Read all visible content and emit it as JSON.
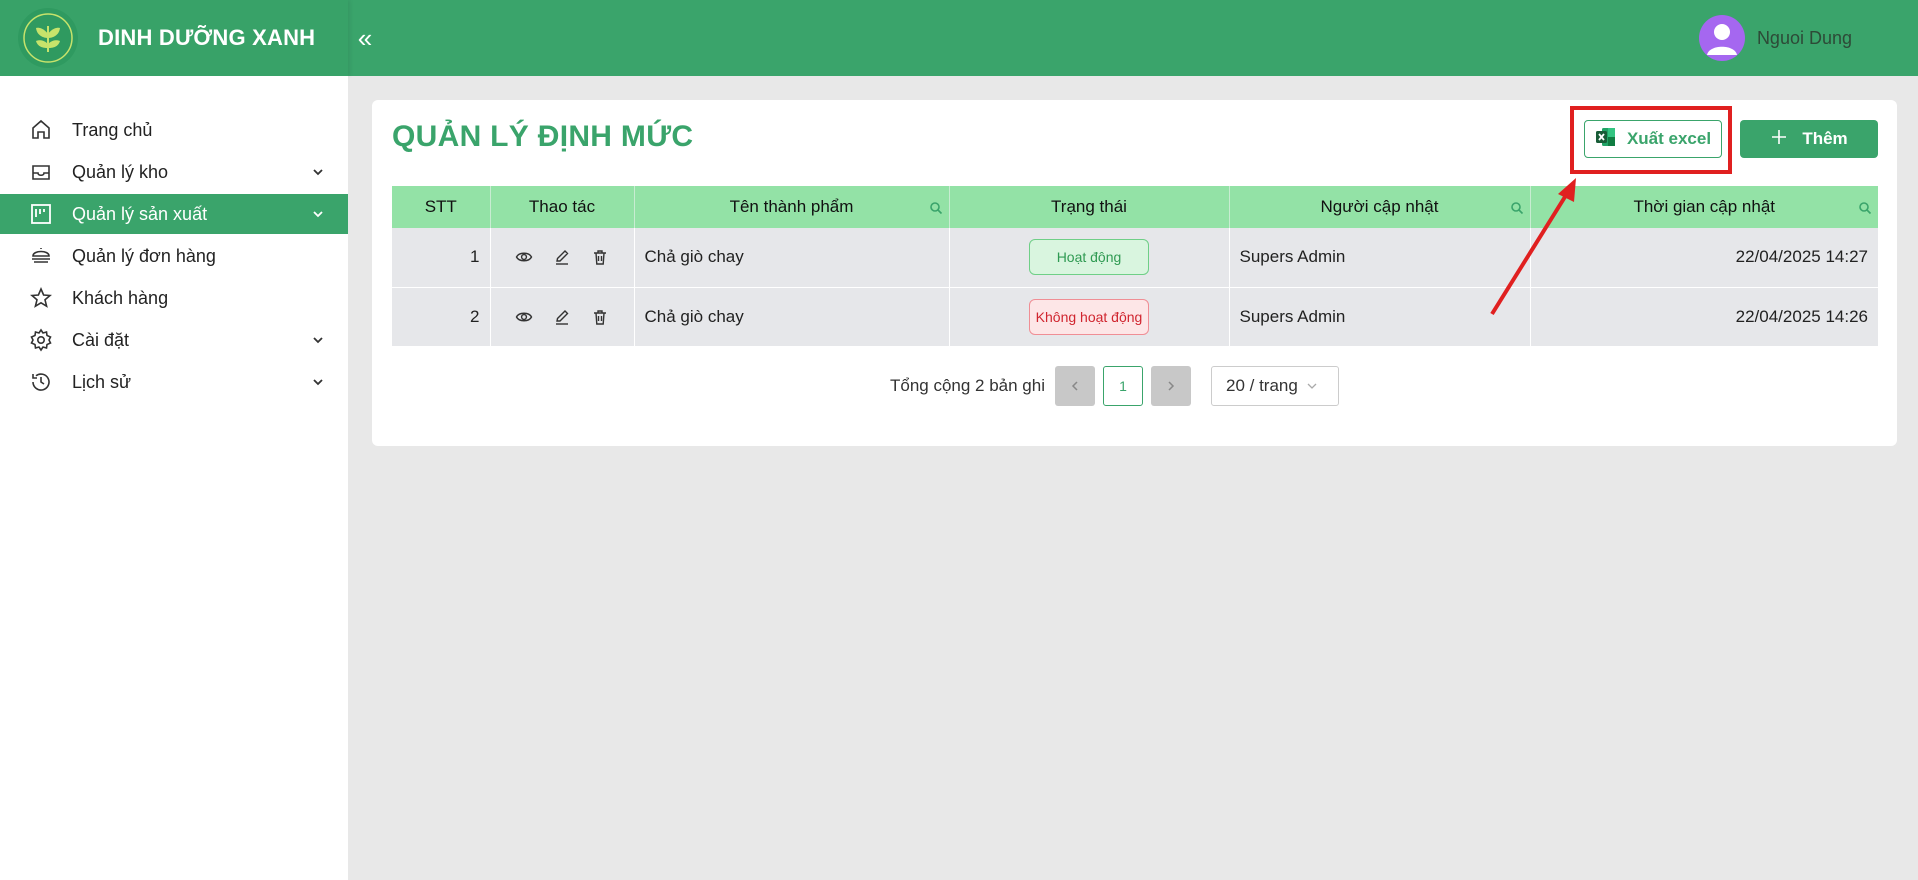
{
  "header": {
    "brand": "DINH DƯỠNG XANH",
    "collapse_icon": "double-chevron-left",
    "user_name": "Nguoi Dung"
  },
  "sidebar": {
    "items": [
      {
        "label": "Trang chủ",
        "icon": "home-icon",
        "has_submenu": false,
        "active": false
      },
      {
        "label": "Quản lý kho",
        "icon": "inbox-icon",
        "has_submenu": true,
        "active": false
      },
      {
        "label": "Quản lý sản xuất",
        "icon": "factory-icon",
        "has_submenu": true,
        "active": true
      },
      {
        "label": "Quản lý đơn hàng",
        "icon": "order-icon",
        "has_submenu": false,
        "active": false
      },
      {
        "label": "Khách hàng",
        "icon": "star-icon",
        "has_submenu": false,
        "active": false
      },
      {
        "label": "Cài đặt",
        "icon": "gear-icon",
        "has_submenu": true,
        "active": false
      },
      {
        "label": "Lịch sử",
        "icon": "history-icon",
        "has_submenu": true,
        "active": false
      }
    ]
  },
  "main": {
    "title": "QUẢN LÝ ĐỊNH MỨC",
    "export_label": "Xuất excel",
    "add_label": "Thêm",
    "table": {
      "columns": [
        "STT",
        "Thao tác",
        "Tên thành phẩm",
        "Trạng thái",
        "Người cập nhật",
        "Thời gian cập nhật"
      ],
      "rows": [
        {
          "stt": "1",
          "name": "Chả giò chay",
          "status": "Hoạt động",
          "status_type": "active",
          "updated_by": "Supers Admin",
          "updated_at": "22/04/2025 14:27"
        },
        {
          "stt": "2",
          "name": "Chả giò chay",
          "status": "Không hoạt động",
          "status_type": "inactive",
          "updated_by": "Supers Admin",
          "updated_at": "22/04/2025 14:26"
        }
      ]
    },
    "pagination": {
      "total_text": "Tổng cộng 2 bản ghi",
      "current_page": "1",
      "page_size": "20 / trang"
    }
  },
  "colors": {
    "brand": "#3aa46b",
    "table_header": "#93e2a6",
    "annotation": "#e02020"
  }
}
